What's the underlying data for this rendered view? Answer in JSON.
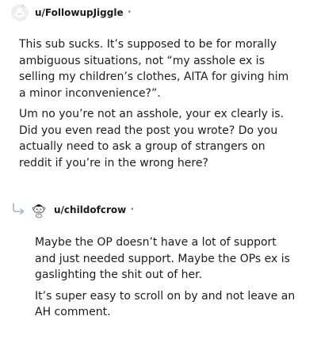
{
  "comment1": {
    "username": "u/FollowupJiggle",
    "separator": "•",
    "paragraphs": [
      "This sub sucks. It’s supposed to be for morally ambiguous situations, not “my asshole ex is selling my children’s clothes, AITA for giving him a minor inconvenience?”.",
      "Um no you’re not an asshole, your ex clearly is. Did you even read the post you wrote? Do you actually need to ask a group of strangers on reddit if you’re in the wrong here?"
    ]
  },
  "comment2": {
    "username": "u/childofcrow",
    "separator": "•",
    "paragraphs": [
      "Maybe the OP doesn’t have a lot of support and just needed support. Maybe the OPs ex is gaslighting the shit out of her.",
      "It’s super easy to scroll on by and not leave an AH comment."
    ]
  },
  "icons": {
    "avatar1": "default-avatar-icon",
    "avatar2": "snoo-avatar-icon",
    "reply": "reply-arrow-icon"
  },
  "colors": {
    "text": "#1c1c1c",
    "meta": "#7c7c7c",
    "reply_arrow": "#a8b4c0"
  }
}
